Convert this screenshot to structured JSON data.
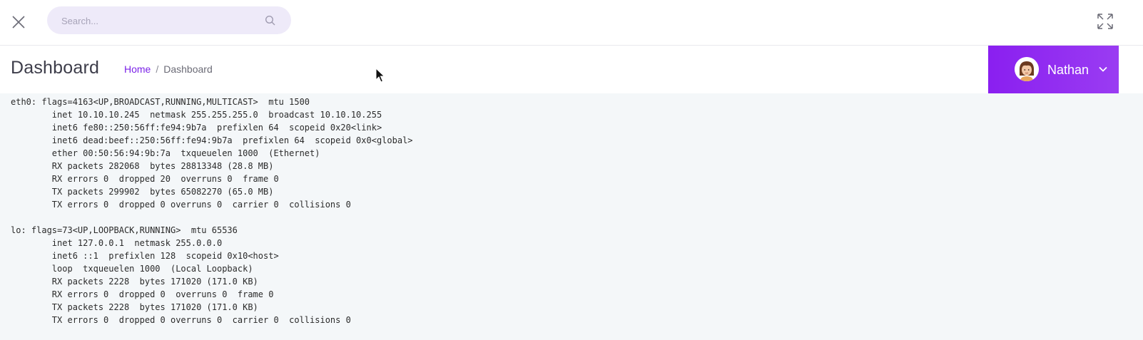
{
  "search": {
    "placeholder": "Search..."
  },
  "header": {
    "title": "Dashboard",
    "breadcrumb": {
      "home": "Home",
      "separator": "/",
      "current": "Dashboard"
    }
  },
  "user": {
    "name": "Nathan"
  },
  "colors": {
    "accent": "#8a1ff0",
    "search_bg": "#eeeaf9",
    "output_bg": "#f4f7f9"
  },
  "output": {
    "text": "eth0: flags=4163<UP,BROADCAST,RUNNING,MULTICAST>  mtu 1500\n        inet 10.10.10.245  netmask 255.255.255.0  broadcast 10.10.10.255\n        inet6 fe80::250:56ff:fe94:9b7a  prefixlen 64  scopeid 0x20<link>\n        inet6 dead:beef::250:56ff:fe94:9b7a  prefixlen 64  scopeid 0x0<global>\n        ether 00:50:56:94:9b:7a  txqueuelen 1000  (Ethernet)\n        RX packets 282068  bytes 28813348 (28.8 MB)\n        RX errors 0  dropped 20  overruns 0  frame 0\n        TX packets 299902  bytes 65082270 (65.0 MB)\n        TX errors 0  dropped 0 overruns 0  carrier 0  collisions 0\n\nlo: flags=73<UP,LOOPBACK,RUNNING>  mtu 65536\n        inet 127.0.0.1  netmask 255.0.0.0\n        inet6 ::1  prefixlen 128  scopeid 0x10<host>\n        loop  txqueuelen 1000  (Local Loopback)\n        RX packets 2228  bytes 171020 (171.0 KB)\n        RX errors 0  dropped 0  overruns 0  frame 0\n        TX packets 2228  bytes 171020 (171.0 KB)\n        TX errors 0  dropped 0 overruns 0  carrier 0  collisions 0"
  }
}
